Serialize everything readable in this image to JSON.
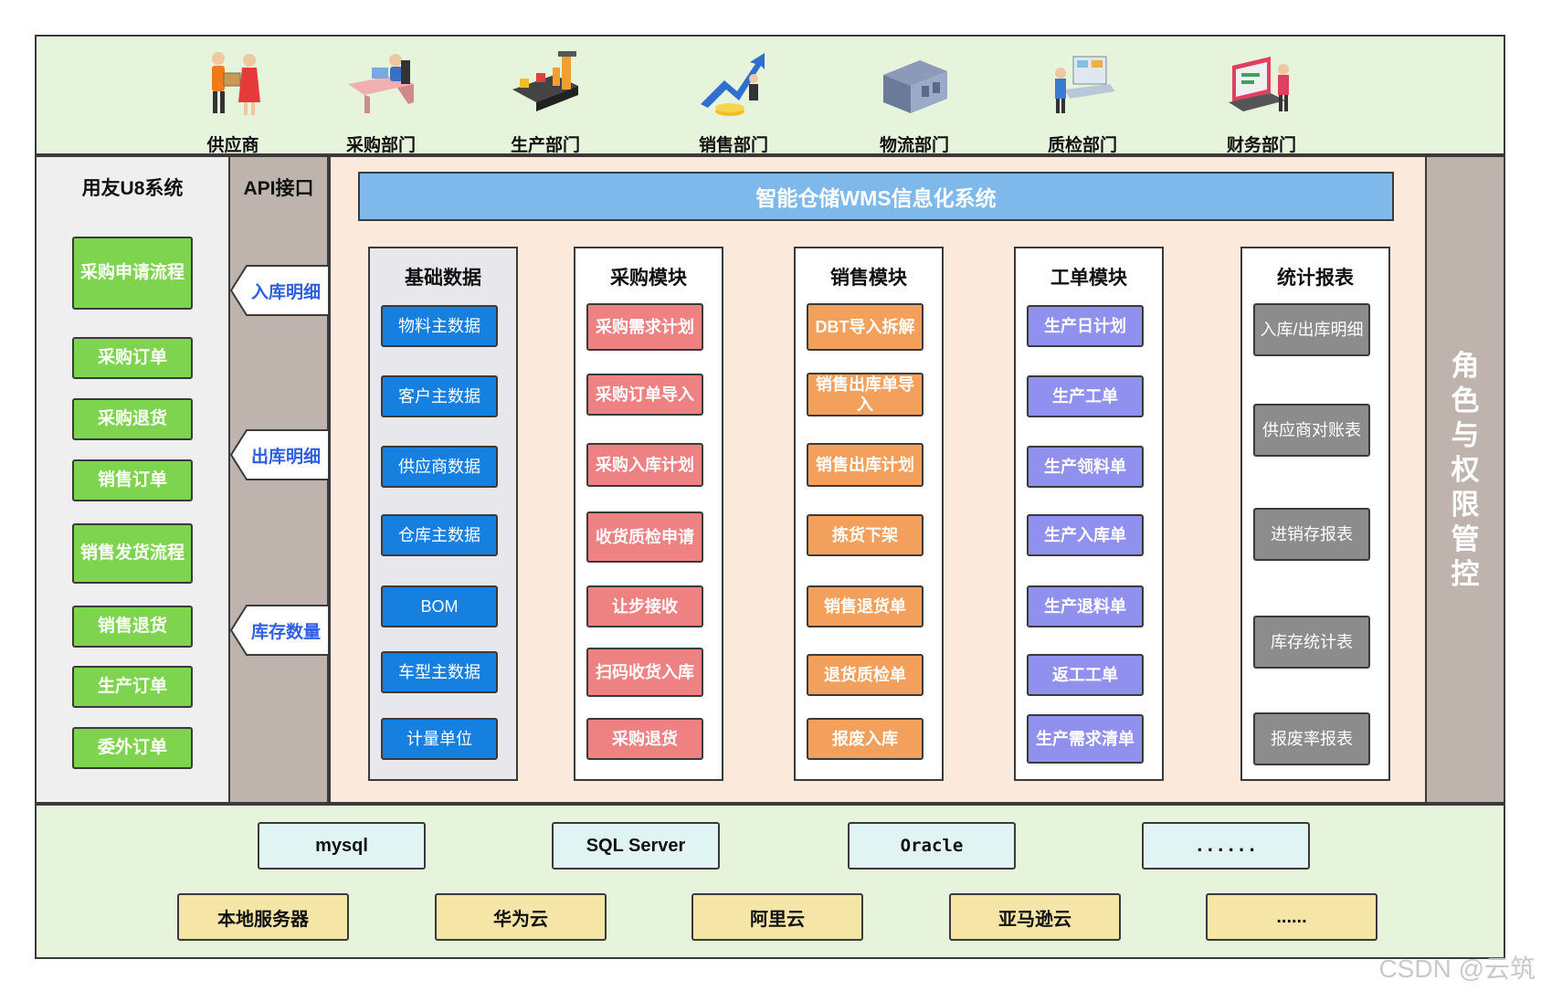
{
  "top_departments": [
    {
      "label": "供应商",
      "icon": "supplier-icon"
    },
    {
      "label": "采购部门",
      "icon": "purchasing-icon"
    },
    {
      "label": "生产部门",
      "icon": "production-icon"
    },
    {
      "label": "销售部门",
      "icon": "sales-icon"
    },
    {
      "label": "物流部门",
      "icon": "warehouse-icon"
    },
    {
      "label": "质检部门",
      "icon": "quality-icon"
    },
    {
      "label": "财务部门",
      "icon": "finance-icon"
    }
  ],
  "u8": {
    "title": "用友U8系统",
    "items": [
      "采购申请流程",
      "采购订单",
      "采购退货",
      "销售订单",
      "销售发货流程",
      "销售退货",
      "生产订单",
      "委外订单"
    ]
  },
  "api": {
    "title": "API接口",
    "labels": [
      "入库明细",
      "出库明细",
      "库存数量"
    ]
  },
  "wms": {
    "title": "智能仓储WMS信息化系统",
    "modules": [
      {
        "title": "基础数据",
        "items": [
          "物料主数据",
          "客户主数据",
          "供应商数据",
          "仓库主数据",
          "BOM",
          "车型主数据",
          "计量单位"
        ]
      },
      {
        "title": "采购模块",
        "items": [
          "采购需求计划",
          "采购订单导入",
          "采购入库计划",
          "收货质检申请",
          "让步接收",
          "扫码收货入库",
          "采购退货"
        ]
      },
      {
        "title": "销售模块",
        "items": [
          "DBT导入拆解",
          "销售出库单导入",
          "销售出库计划",
          "拣货下架",
          "销售退货单",
          "退货质检单",
          "报废入库"
        ]
      },
      {
        "title": "工单模块",
        "items": [
          "生产日计划",
          "生产工单",
          "生产领料单",
          "生产入库单",
          "生产退料单",
          "返工工单",
          "生产需求清单"
        ]
      },
      {
        "title": "统计报表",
        "items": [
          "入库/出库明细",
          "供应商对账表",
          "进销存报表",
          "库存统计表",
          "报废率报表"
        ]
      }
    ]
  },
  "role_label": "角色与权限管控",
  "databases": [
    "mysql",
    "SQL Server",
    "Oracle",
    "......"
  ],
  "servers": [
    "本地服务器",
    "华为云",
    "阿里云",
    "亚马逊云",
    "......"
  ],
  "watermark": "CSDN @云筑",
  "colors": {
    "green_btn": "#7fd44f",
    "blue_btn": "#1580e0",
    "red_btn": "#ee8282",
    "orange_btn": "#f2a05c",
    "purple_btn": "#9090ee",
    "gray_btn": "#8c8c8c",
    "banner": "#7fb9ec"
  }
}
